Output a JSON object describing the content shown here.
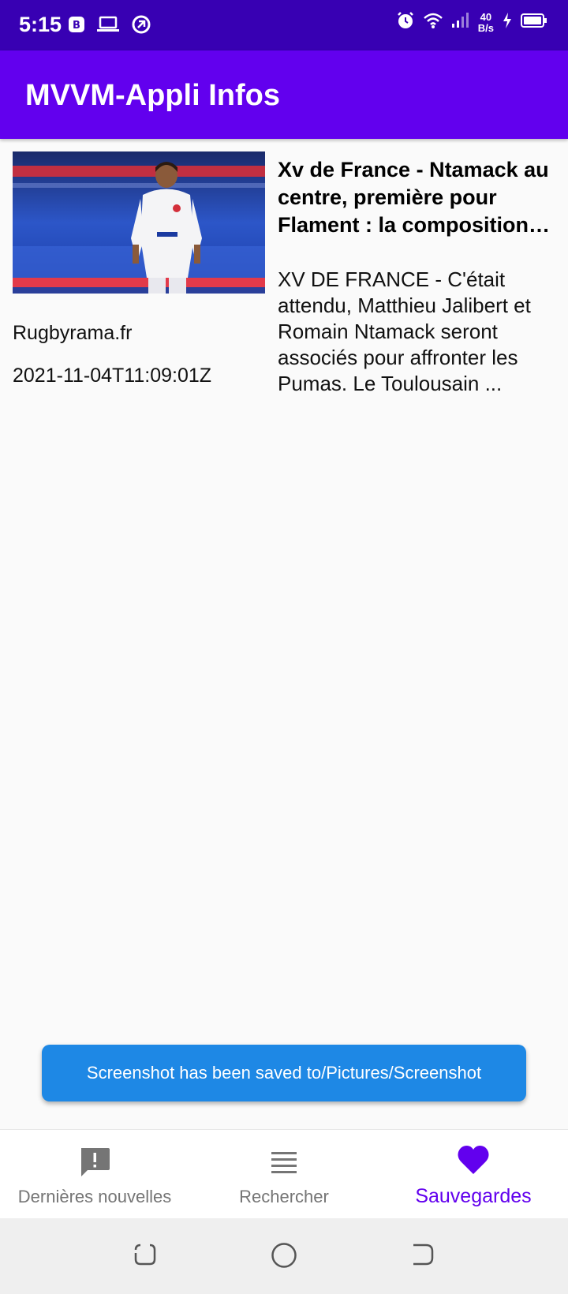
{
  "status_bar": {
    "time": "5:15",
    "net_speed_value": "40",
    "net_speed_unit": "B/s",
    "icons": [
      "b-badge-icon",
      "laptop-icon",
      "vpn-icon",
      "alarm-icon",
      "wifi-icon",
      "signal-icon",
      "charging-icon",
      "battery-icon"
    ]
  },
  "app_bar": {
    "title": "MVVM-Appli Infos",
    "color": "#6200ee"
  },
  "articles": [
    {
      "title": "Xv de France - Ntamack au centre, première pour Flament : la composition du XV de France",
      "description": "XV DE FRANCE - C'était attendu, Matthieu Jalibert et Romain Ntamack seront associés pour affronter les Pumas. Le Toulousain ...",
      "source": "Rugbyrama.fr",
      "published_at": "2021-11-04T11:09:01Z",
      "image": "rugby-player-photo"
    }
  ],
  "toast": {
    "message": "Screenshot has been saved to/Pictures/Screenshot",
    "color": "#1e88e5"
  },
  "bottom_nav": {
    "items": [
      {
        "label": "Dernières nouvelles",
        "icon": "alert-message-icon",
        "active": false
      },
      {
        "label": "Rechercher",
        "icon": "list-icon",
        "active": false
      },
      {
        "label": "Sauvegardes",
        "icon": "heart-icon",
        "active": true
      }
    ],
    "active_color": "#6200ee",
    "inactive_color": "#757575"
  },
  "system_nav": {
    "buttons": [
      "recent-apps-icon",
      "home-icon",
      "back-icon"
    ]
  }
}
